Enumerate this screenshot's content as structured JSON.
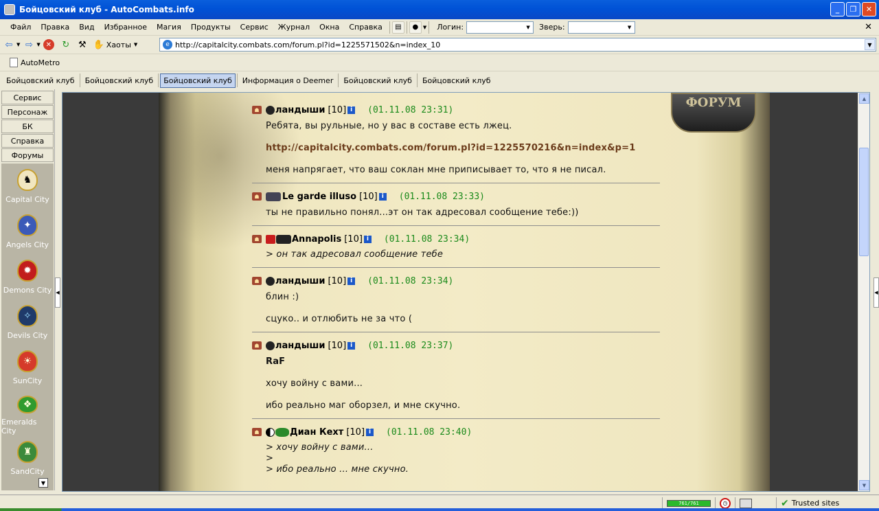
{
  "window": {
    "title": "Бойцовский клуб - AutoCombats.info"
  },
  "menu": {
    "items": [
      "Файл",
      "Правка",
      "Вид",
      "Избранное",
      "Магия",
      "Продукты",
      "Сервис",
      "Журнал",
      "Окна",
      "Справка"
    ],
    "login_label": "Логин:",
    "beast_label": "Зверь:"
  },
  "toolbar": {
    "chaos_label": "Хаоты"
  },
  "address": {
    "url": "http://capitalcity.combats.com/forum.pl?id=1225571502&n=index_10"
  },
  "links": {
    "automatro": "AutoMetro"
  },
  "tabs": [
    "Бойцовский клуб",
    "Бойцовский клуб",
    "Бойцовский клуб",
    "Информация о Deemer",
    "Бойцовский клуб",
    "Бойцовский клуб"
  ],
  "active_tab_index": 2,
  "sidebar": {
    "buttons": [
      "Сервис",
      "Персонаж",
      "БК",
      "Справка",
      "Форумы"
    ],
    "cities": [
      "Capital City",
      "Angels City",
      "Demons City",
      "Devils City",
      "SunCity",
      "Emeralds City",
      "SandCity"
    ]
  },
  "forum": {
    "logo": "ФОРУМ",
    "posts": [
      {
        "nick": "ландыши",
        "level": "[10]",
        "date": "01.11.08 23:31",
        "body": [
          {
            "t": "text",
            "v": "Ребята, вы рульные, но у вас в составе есть лжец."
          },
          {
            "t": "link",
            "v": "http://capitalcity.combats.com/forum.pl?id=1225570216&n=index&p=1"
          },
          {
            "t": "text",
            "v": "меня напрягает, что ваш соклан мне приписывает то, что я не писал."
          }
        ]
      },
      {
        "nick": "Le garde illuso",
        "level": "[10]",
        "date": "01.11.08 23:33",
        "body": [
          {
            "t": "text",
            "v": "ты не правильно понял...эт он так адресовал сообщение тебе:))"
          }
        ]
      },
      {
        "nick": "Annapolis",
        "level": "[10]",
        "date": "01.11.08 23:34",
        "body": [
          {
            "t": "quote",
            "v": "> он так адресовал сообщение тебе"
          }
        ]
      },
      {
        "nick": "ландыши",
        "level": "[10]",
        "date": "01.11.08 23:34",
        "body": [
          {
            "t": "text",
            "v": "блин :)"
          },
          {
            "t": "text",
            "v": "сцуко.. и отлюбить не за что ("
          }
        ]
      },
      {
        "nick": "ландыши",
        "level": "[10]",
        "date": "01.11.08 23:37",
        "body": [
          {
            "t": "bold",
            "v": "RaF"
          },
          {
            "t": "text",
            "v": "хочу войну с вами..."
          },
          {
            "t": "text",
            "v": "ибо реально маг оборзел, и мне скучно."
          }
        ]
      },
      {
        "nick": "Диан Кехт",
        "level": "[10]",
        "date": "01.11.08 23:40",
        "body": [
          {
            "t": "quote",
            "v": "> хочу войну с вами..."
          },
          {
            "t": "quote",
            "v": ">"
          },
          {
            "t": "quote",
            "v": "> ибо реально ... мне скучно."
          }
        ]
      }
    ]
  },
  "status": {
    "hp": "761/761",
    "zone": "Trusted sites"
  },
  "colors": {
    "title_blue": "#0052d6",
    "date_green": "#1a8a1a",
    "parchment": "#f3ebc7"
  }
}
